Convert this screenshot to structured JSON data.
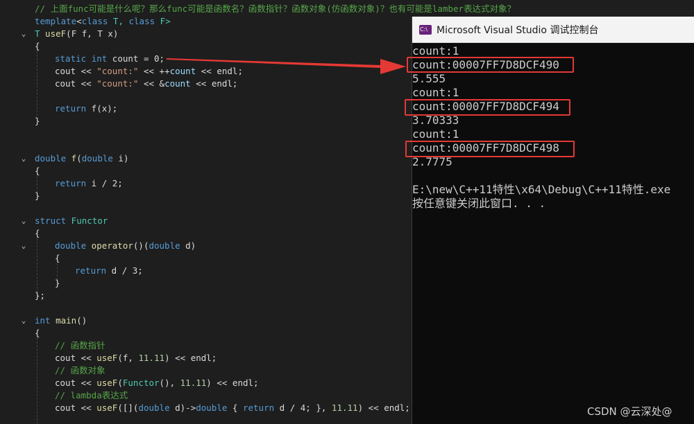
{
  "editor": {
    "comment_top": "// 上面func可能是什么呢？那么func可能是函数名？函数指针？函数对象(仿函数对象)？也有可能是lamber表达式对象？",
    "tpl_kw": "template",
    "tpl_rest_a": "<",
    "tpl_class1": "class",
    "tpl_T": " T, ",
    "tpl_class2": "class",
    "tpl_F": " F>",
    "usef_ret": "T",
    "usef_name": " useF",
    "usef_params": "(F f, T x)",
    "brace_open": "{",
    "brace_close": "}",
    "brace_close_semi": "};",
    "static_kw": "static",
    "int_kw": "int",
    "count_decl_rest": " count = 0;",
    "cout1_a": "cout << ",
    "cout1_str": "\"count:\"",
    "cout1_b": " << ++",
    "cout1_count": "count",
    "cout1_c": " << endl;",
    "cout2_a": "cout << ",
    "cout2_str": "\"count:\"",
    "cout2_b": " << &",
    "cout2_count": "count",
    "cout2_c": " << endl;",
    "return_kw": "return",
    "return_fx": " f(x);",
    "double_kw": "double",
    "f_name": " f",
    "f_params_a": "(",
    "f_params_b": " i)",
    "return_i": " i / 2;",
    "struct_kw": "struct",
    "functor_name": " Functor",
    "op_double": "double",
    "op_name": " operator",
    "op_params_a": "()(",
    "op_params_b": " d)",
    "return_d3": " d / 3;",
    "main_int": "int",
    "main_name": " main",
    "main_parens": "()",
    "cm_fnptr": "// 函数指针",
    "call1_a": "cout << ",
    "call1_fn": "useF",
    "call1_b": "(f, ",
    "call1_num": "11.11",
    "call1_c": ") << endl;",
    "cm_fnobj": "// 函数对象",
    "call2_a": "cout << ",
    "call2_fn": "useF",
    "call2_b": "(",
    "call2_ty": "Functor",
    "call2_c": "(), ",
    "call2_num": "11.11",
    "call2_d": ") << endl;",
    "cm_lambda": "// lambda表达式",
    "call3_a": "cout << ",
    "call3_fn": "useF",
    "call3_b": "([](",
    "call3_dbl": "double",
    "call3_c": " d)->",
    "call3_dbl2": "double",
    "call3_d": " { ",
    "call3_ret": "return",
    "call3_e": " d / 4; }, ",
    "call3_num": "11.11",
    "call3_f": ") << endl;"
  },
  "console": {
    "title": "Microsoft Visual Studio 调试控制台",
    "icon_label": "C:\\",
    "lines": [
      "count:1",
      "count:00007FF7D8DCF490",
      "5.555",
      "count:1",
      "count:00007FF7D8DCF494",
      "3.70333",
      "count:1",
      "count:00007FF7D8DCF498",
      "2.7775",
      "",
      "E:\\new\\C++11特性\\x64\\Debug\\C++11特性.exe",
      "按任意键关闭此窗口. . ."
    ]
  },
  "annotation_color": "#e53935",
  "watermark": "CSDN @云深处@"
}
